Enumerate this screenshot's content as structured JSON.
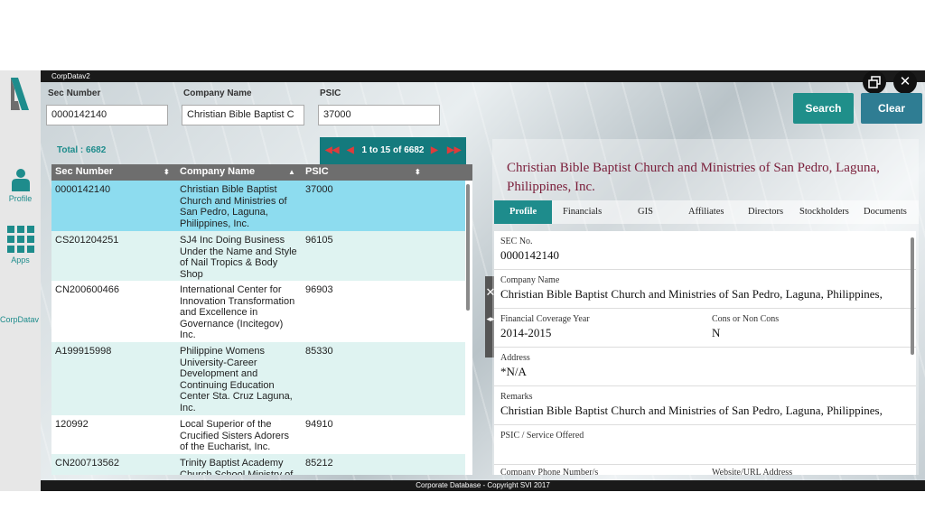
{
  "window": {
    "title": "CorpDatav2",
    "footer": "Corporate Database - Copyright SVI 2017"
  },
  "sidebar": {
    "items": [
      {
        "label": "Profile",
        "icon": "person-icon"
      },
      {
        "label": "Apps",
        "icon": "apps-grid-icon"
      },
      {
        "label": "CorpDatav",
        "icon": ""
      }
    ]
  },
  "search": {
    "sec_label": "Sec Number",
    "sec_value": "0000142140",
    "company_label": "Company Name",
    "company_value": "Christian Bible Baptist C",
    "psic_label": "PSIC",
    "psic_value": "37000",
    "search_button": "Search",
    "clear_button": "Clear"
  },
  "results": {
    "total": "Total : 6682",
    "pager": "1 to 15 of 6682",
    "columns": [
      "Sec Number",
      "Company Name",
      "PSIC"
    ],
    "rows": [
      {
        "sec": "0000142140",
        "name": "Christian Bible Baptist Church and Ministries of San Pedro, Laguna, Philippines, Inc.",
        "psic": "37000",
        "selected": true
      },
      {
        "sec": "CS201204251",
        "name": "SJ4 Inc Doing Business Under the Name and Style of Nail Tropics & Body Shop",
        "psic": "96105"
      },
      {
        "sec": "CN200600466",
        "name": "International Center for Innovation Transformation and Excellence in Governance (Incitegov) Inc.",
        "psic": "96903"
      },
      {
        "sec": "A199915998",
        "name": "Philippine Womens University-Career Development and Continuing Education Center Sta. Cruz Laguna, Inc.",
        "psic": "85330"
      },
      {
        "sec": "120992",
        "name": "Local Superior of the Crucified Sisters Adorers of the Eucharist, Inc.",
        "psic": "94910"
      },
      {
        "sec": "CN200713562",
        "name": "Trinity Baptist Academy Church School Ministry of",
        "psic": "85212"
      }
    ]
  },
  "detail": {
    "title": "Christian Bible Baptist Church and Ministries of San Pedro, Laguna, Philippines, Inc.",
    "tabs": [
      "Profile",
      "Financials",
      "GIS",
      "Affiliates",
      "Directors",
      "Stockholders",
      "Documents"
    ],
    "sec_no_label": "SEC No.",
    "sec_no_value": "0000142140",
    "company_name_label": "Company Name",
    "company_name_value": "Christian Bible Baptist Church and Ministries of San Pedro, Laguna, Philippines,",
    "fin_year_label": "Financial Coverage Year",
    "fin_year_value": "2014-2015",
    "cons_label": "Cons or Non Cons",
    "cons_value": "N",
    "address_label": "Address",
    "address_value": "*N/A",
    "remarks_label": "Remarks",
    "remarks_value": "Christian Bible Baptist Church and Ministries of San Pedro, Laguna, Philippines,",
    "psic_service_label": "PSIC / Service Offered",
    "phone_label": "Company Phone Number/s",
    "website_label": "Website/URL Address"
  },
  "colors": {
    "teal": "#1e8c8c",
    "search_btn": "#1f8f8a",
    "clear_btn": "#2f7d93",
    "selected_row": "#8ddcef",
    "alt_row": "#dff3f1",
    "title_maroon": "#7a1e3a"
  }
}
